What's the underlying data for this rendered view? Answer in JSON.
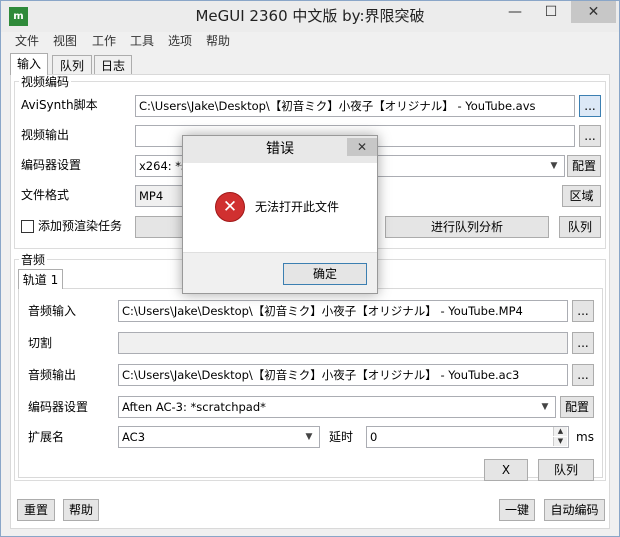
{
  "window": {
    "title": "MeGUI 2360 中文版 by:界限突破",
    "app_icon": "m",
    "minimize": "—",
    "maximize": "☐",
    "close": "✕"
  },
  "menu": [
    "文件",
    "视图",
    "工作",
    "工具",
    "选项",
    "帮助"
  ],
  "tabs": [
    "输入",
    "队列",
    "日志"
  ],
  "video": {
    "group_title": "视频编码",
    "avisynth_label": "AviSynth脚本",
    "avisynth_value": "C:\\Users\\Jake\\Desktop\\【初音ミク】小夜子【オリジナル】 - YouTube.avs",
    "output_label": "视频输出",
    "output_value": "",
    "encoder_label": "编码器设置",
    "encoder_value": "x264: *sc",
    "config_button": "配置",
    "format_label": "文件格式",
    "format_value": "MP4",
    "region_button": "区域",
    "prerender_label": "添加预渲染任务",
    "analysis_button": "进行队列分析",
    "queue_button": "队列",
    "browse_button": "..."
  },
  "audio": {
    "group_title": "音频",
    "track_tab": "轨道 1",
    "input_label": "音频输入",
    "input_value": "C:\\Users\\Jake\\Desktop\\【初音ミク】小夜子【オリジナル】 - YouTube.MP4",
    "cut_label": "切割",
    "cut_value": "",
    "output_label": "音频输出",
    "output_value": "C:\\Users\\Jake\\Desktop\\【初音ミク】小夜子【オリジナル】 - YouTube.ac3",
    "encoder_label": "编码器设置",
    "encoder_value": "Aften AC-3: *scratchpad*",
    "config_button": "配置",
    "ext_label": "扩展名",
    "ext_value": "AC3",
    "delay_label": "延时",
    "delay_value": "0",
    "delay_unit": "ms",
    "x_button": "X",
    "queue_button": "队列",
    "browse_button": "..."
  },
  "bottom": {
    "reset": "重置",
    "help": "帮助",
    "one_click": "一键",
    "auto_encode": "自动编码"
  },
  "dialog": {
    "title": "错误",
    "message": "无法打开此文件",
    "ok": "确定",
    "close": "✕",
    "icon_glyph": "✕"
  }
}
